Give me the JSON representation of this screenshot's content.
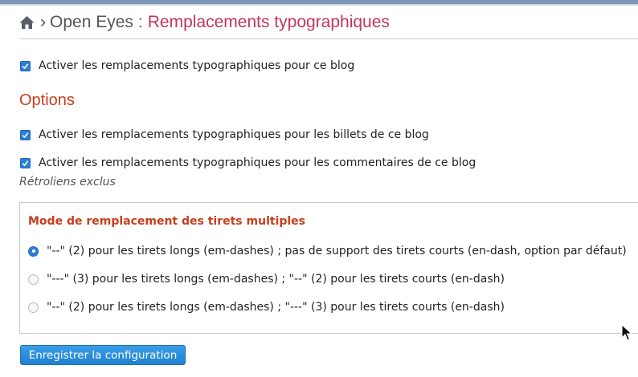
{
  "breadcrumb": {
    "separator": "›",
    "blog_name": "Open Eyes",
    "colon": ":",
    "page_title": "Remplacements typographiques"
  },
  "main_option": {
    "label": "Activer les remplacements typographiques pour ce blog",
    "checked": true
  },
  "options": {
    "title": "Options",
    "posts_label": "Activer les remplacements typographiques pour les billets de ce blog",
    "posts_checked": true,
    "comments_label": "Activer les remplacements typographiques pour les commentaires de ce blog",
    "comments_checked": true,
    "excluded_note": "Rétroliens exclus"
  },
  "dash_mode": {
    "legend": "Mode de remplacement des tirets multiples",
    "choices": [
      {
        "label": "\"--\" (2) pour les tirets longs (em-dashes) ; pas de support des tirets courts (en-dash, option par défaut)",
        "selected": true
      },
      {
        "label": "\"---\" (3) pour les tirets longs (em-dashes) ; \"--\" (2) pour les tirets courts (en-dash)",
        "selected": false
      },
      {
        "label": "\"--\" (2) pour les tirets longs (em-dashes) ; \"---\" (3) pour les tirets courts (en-dash)",
        "selected": false
      }
    ]
  },
  "save_button": {
    "label": "Enregistrer la configuration"
  },
  "colors": {
    "title_accent": "#c3355c",
    "section_heading": "#c73e1d",
    "control_blue": "#2d7fd6"
  }
}
